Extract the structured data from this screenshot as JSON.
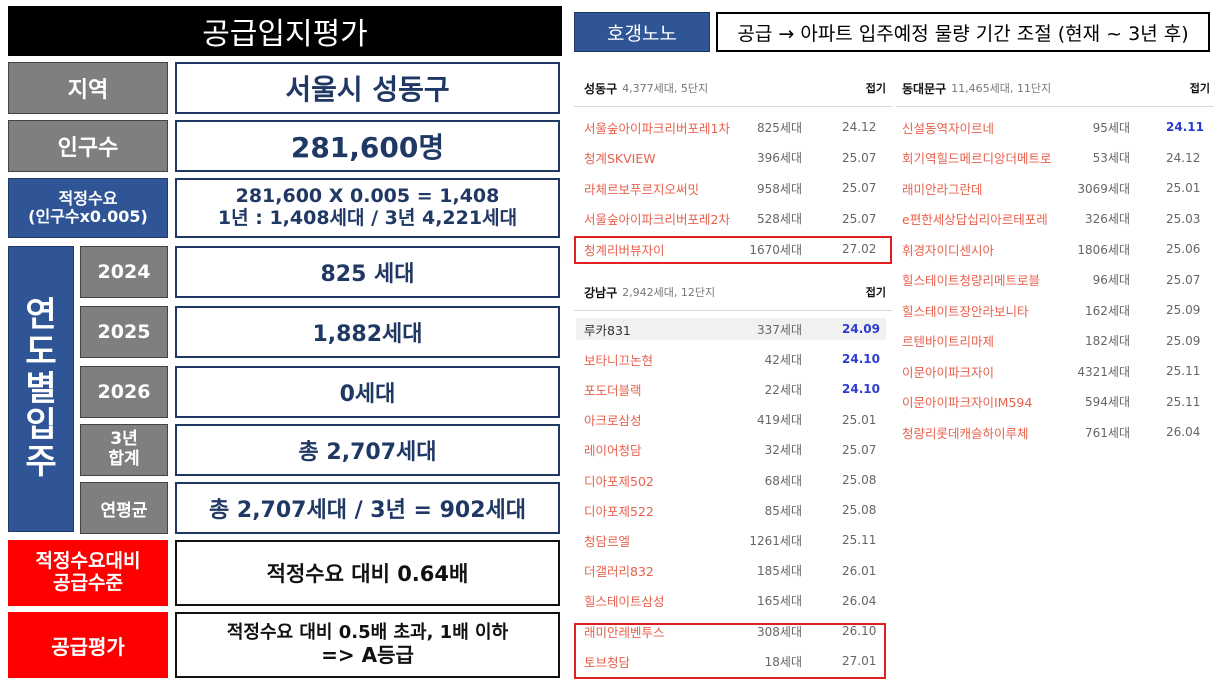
{
  "left": {
    "title": "공급입지평가",
    "region_label": "지역",
    "region_value": "서울시 성동구",
    "population_label": "인구수",
    "population_value": "281,600명",
    "demand_label_1": "적정수요",
    "demand_label_2": "(인구수x0.005)",
    "demand_value_1": "281,600 X 0.005 = 1,408",
    "demand_value_2": "1년 : 1,408세대 / 3년 4,221세대",
    "yearly_label_chars": [
      "연",
      "도",
      "별",
      "입",
      "주"
    ],
    "years": [
      {
        "label": "2024",
        "value": "825 세대"
      },
      {
        "label": "2025",
        "value": "1,882세대"
      },
      {
        "label": "2026",
        "value": "0세대"
      }
    ],
    "total_label_1": "3년",
    "total_label_2": "합계",
    "total_value": "총 2,707세대",
    "avg_label": "연평균",
    "avg_value": "총 2,707세대 / 3년 = 902세대",
    "ratio_label_1": "적정수요대비",
    "ratio_label_2": "공급수준",
    "ratio_value": "적정수요 대비 0.64배",
    "eval_label": "공급평가",
    "eval_value_1": "적정수요 대비 0.5배 초과, 1배 이하",
    "eval_value_2": "=> A등급"
  },
  "right": {
    "tag": "호갱노노",
    "desc": "공급 → 아파트 입주예정 물량 기간 조절 (현재 ~ 3년 후)",
    "panels": [
      {
        "name": "성동구",
        "info": "4,377세대, 5단지",
        "fold": "접기",
        "rows": [
          {
            "name": "서울숲아이파크리버포레1차",
            "count": "825세대",
            "date": "24.12"
          },
          {
            "name": "청계SKVIEW",
            "count": "396세대",
            "date": "25.07"
          },
          {
            "name": "라체르보푸르지오써밋",
            "count": "958세대",
            "date": "25.07"
          },
          {
            "name": "서울숲아이파크리버포레2차",
            "count": "528세대",
            "date": "25.07"
          },
          {
            "name": "청계리버뷰자이",
            "count": "1670세대",
            "date": "27.02"
          }
        ]
      },
      {
        "name": "강남구",
        "info": "2,942세대, 12단지",
        "fold": "접기",
        "rows": [
          {
            "name": "루카831",
            "count": "337세대",
            "date": "24.09"
          },
          {
            "name": "보타니끄논현",
            "count": "42세대",
            "date": "24.10"
          },
          {
            "name": "포도더블랙",
            "count": "22세대",
            "date": "24.10"
          },
          {
            "name": "아크로삼성",
            "count": "419세대",
            "date": "25.01"
          },
          {
            "name": "레이어청담",
            "count": "32세대",
            "date": "25.07"
          },
          {
            "name": "디아포제502",
            "count": "68세대",
            "date": "25.08"
          },
          {
            "name": "디아포제522",
            "count": "85세대",
            "date": "25.08"
          },
          {
            "name": "청담르엘",
            "count": "1261세대",
            "date": "25.11"
          },
          {
            "name": "더갤러리832",
            "count": "185세대",
            "date": "26.01"
          },
          {
            "name": "힐스테이트삼성",
            "count": "165세대",
            "date": "26.04"
          },
          {
            "name": "래미안레벤투스",
            "count": "308세대",
            "date": "26.10"
          },
          {
            "name": "토브청담",
            "count": "18세대",
            "date": "27.01"
          }
        ]
      },
      {
        "name": "동대문구",
        "info": "11,465세대, 11단지",
        "fold": "접기",
        "rows": [
          {
            "name": "신설동역자이르네",
            "count": "95세대",
            "date": "24.11"
          },
          {
            "name": "회기역힐드메르디앙더메트로",
            "count": "53세대",
            "date": "24.12"
          },
          {
            "name": "래미안라그란데",
            "count": "3069세대",
            "date": "25.01"
          },
          {
            "name": "e편한세상답십리아르테포레",
            "count": "326세대",
            "date": "25.03"
          },
          {
            "name": "휘경자이디센시아",
            "count": "1806세대",
            "date": "25.06"
          },
          {
            "name": "힐스테이트청량리메트로블",
            "count": "96세대",
            "date": "25.07"
          },
          {
            "name": "힐스테이트장안라보니타",
            "count": "162세대",
            "date": "25.09"
          },
          {
            "name": "르텐바이트리마제",
            "count": "182세대",
            "date": "25.09"
          },
          {
            "name": "이문아이파크자이",
            "count": "4321세대",
            "date": "25.11"
          },
          {
            "name": "이문아이파크자이IM594",
            "count": "594세대",
            "date": "25.11"
          },
          {
            "name": "청량리롯데캐슬하이루체",
            "count": "761세대",
            "date": "26.04"
          }
        ]
      }
    ]
  }
}
